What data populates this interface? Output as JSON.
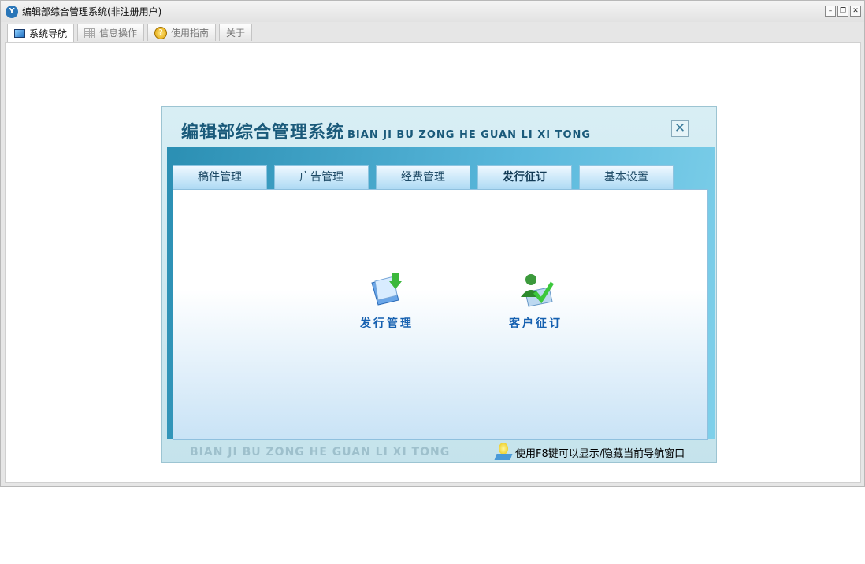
{
  "window": {
    "title": "编辑部综合管理系统(非注册用户)",
    "controls": [
      "minimize",
      "restore",
      "close"
    ]
  },
  "tabs": [
    {
      "label": "系统导航",
      "icon": "nav-icon"
    },
    {
      "label": "信息操作",
      "icon": "grid-icon"
    },
    {
      "label": "使用指南",
      "icon": "help-icon"
    },
    {
      "label": "关于"
    }
  ],
  "dialog": {
    "title": "编辑部综合管理系统",
    "subtitle": "BIAN JI BU ZONG HE GUAN LI XI TONG",
    "close": "✕",
    "tabs": [
      "稿件管理",
      "广告管理",
      "经费管理",
      "发行征订",
      "基本设置"
    ],
    "active_tab": "发行征订",
    "items": [
      {
        "label": "发行管理",
        "icon": "distribution-icon"
      },
      {
        "label": "客户征订",
        "icon": "customer-subscribe-icon"
      }
    ],
    "footer_text": "BIAN JI BU ZONG HE GUAN LI XI TONG",
    "tip": "使用F8键可以显示/隐藏当前导航窗口"
  }
}
